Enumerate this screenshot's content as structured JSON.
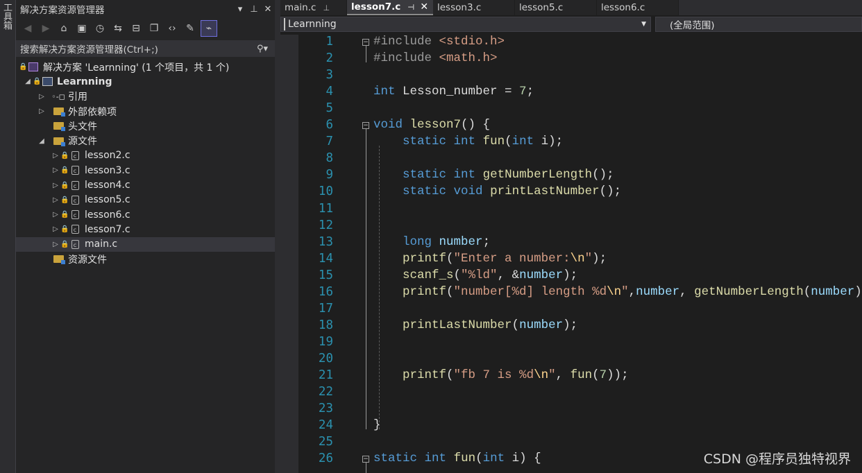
{
  "toolbox": {
    "label": "工具箱"
  },
  "solution_explorer": {
    "title": "解决方案资源管理器",
    "search_placeholder": "搜索解决方案资源管理器(Ctrl+;)",
    "solution_label": "解决方案 'Learnning' (1 个项目，共 1 个)",
    "project_label": "Learnning",
    "references_label": "引用",
    "external_deps_label": "外部依赖项",
    "headers_label": "头文件",
    "sources_label": "源文件",
    "resources_label": "资源文件",
    "source_files": [
      "lesson2.c",
      "lesson3.c",
      "lesson4.c",
      "lesson5.c",
      "lesson6.c",
      "lesson7.c",
      "main.c"
    ],
    "selected_file": "main.c"
  },
  "tabs": [
    {
      "label": "main.c",
      "active": false
    },
    {
      "label": "lesson7.c",
      "active": true
    },
    {
      "label": "lesson3.c",
      "active": false
    },
    {
      "label": "lesson5.c",
      "active": false
    },
    {
      "label": "lesson6.c",
      "active": false
    }
  ],
  "navbar": {
    "project": "Learnning",
    "scope": "(全局范围)"
  },
  "code_lines": [
    "#include <stdio.h>",
    "#include <math.h>",
    "",
    "int Lesson_number = 7;",
    "",
    "void lesson7() {",
    "    static int fun(int i);",
    "",
    "    static int getNumberLength();",
    "    static void printLastNumber();",
    "",
    "",
    "    long number;",
    "    printf(\"Enter a number:\\n\");",
    "    scanf_s(\"%ld\", &number);",
    "    printf(\"number[%d] length %d\\n\",number, getNumberLength(number));",
    "",
    "    printLastNumber(number);",
    "",
    "",
    "    printf(\"fb 7 is %d\\n\", fun(7));",
    "",
    "",
    "}",
    "",
    "static int fun(int i) {"
  ],
  "watermark": "CSDN @程序员独特视界"
}
